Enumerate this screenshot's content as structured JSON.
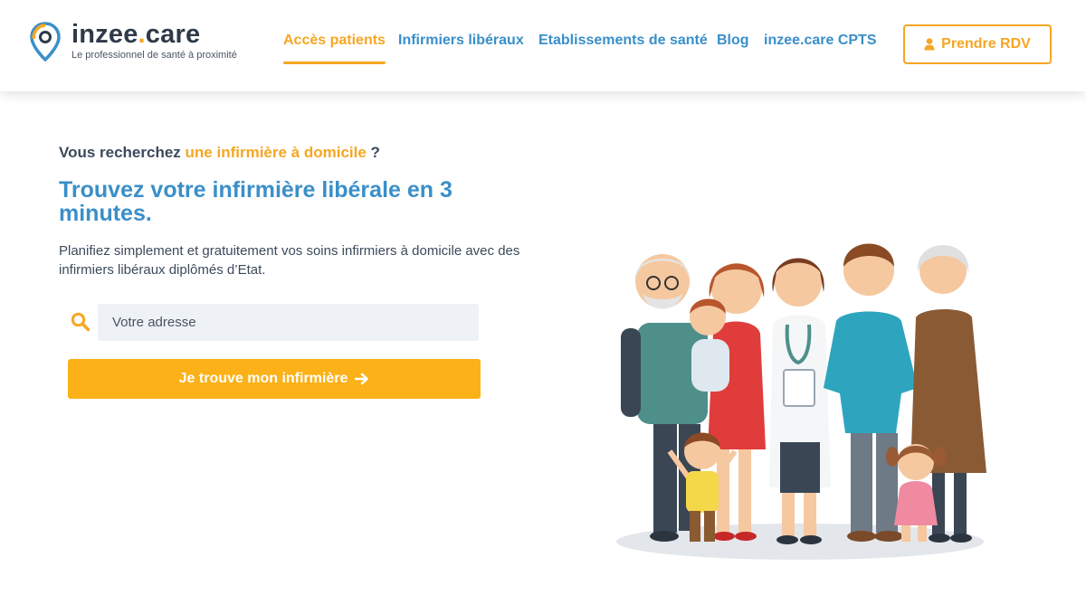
{
  "brand": {
    "name_main": "inzee",
    "name_dot": ".",
    "name_suffix": "care",
    "tagline": "Le professionnel de santé à proximité"
  },
  "nav": {
    "items": [
      {
        "label": "Accès patients",
        "active": true
      },
      {
        "label": "Infirmiers libéraux",
        "active": false
      },
      {
        "label": "Etablissements de santé",
        "active": false
      },
      {
        "label": "Blog",
        "active": false
      },
      {
        "label": "inzee.care CPTS",
        "active": false
      }
    ],
    "cta_label": "Prendre RDV",
    "cta_icon": "user-icon"
  },
  "hero": {
    "kicker_prefix": "Vous recherchez ",
    "kicker_highlight": "une infirmière à domicile",
    "kicker_suffix": " ?",
    "title": "Trouvez votre infirmière libérale en 3 minutes.",
    "description": "Planifiez simplement et gratuitement vos soins infirmiers à domicile avec des infirmiers libéraux diplômés d’Etat.",
    "search": {
      "placeholder": "Votre adresse",
      "value": "",
      "icon": "search-icon"
    },
    "cta_label": "Je trouve mon infirmière",
    "cta_icon": "arrow-right-icon"
  },
  "colors": {
    "accent_orange": "#f6a623",
    "button_orange": "#fbb117",
    "brand_blue": "#3a8fc9",
    "text_dark": "#3c4a5c",
    "input_bg": "#eef2f6"
  }
}
